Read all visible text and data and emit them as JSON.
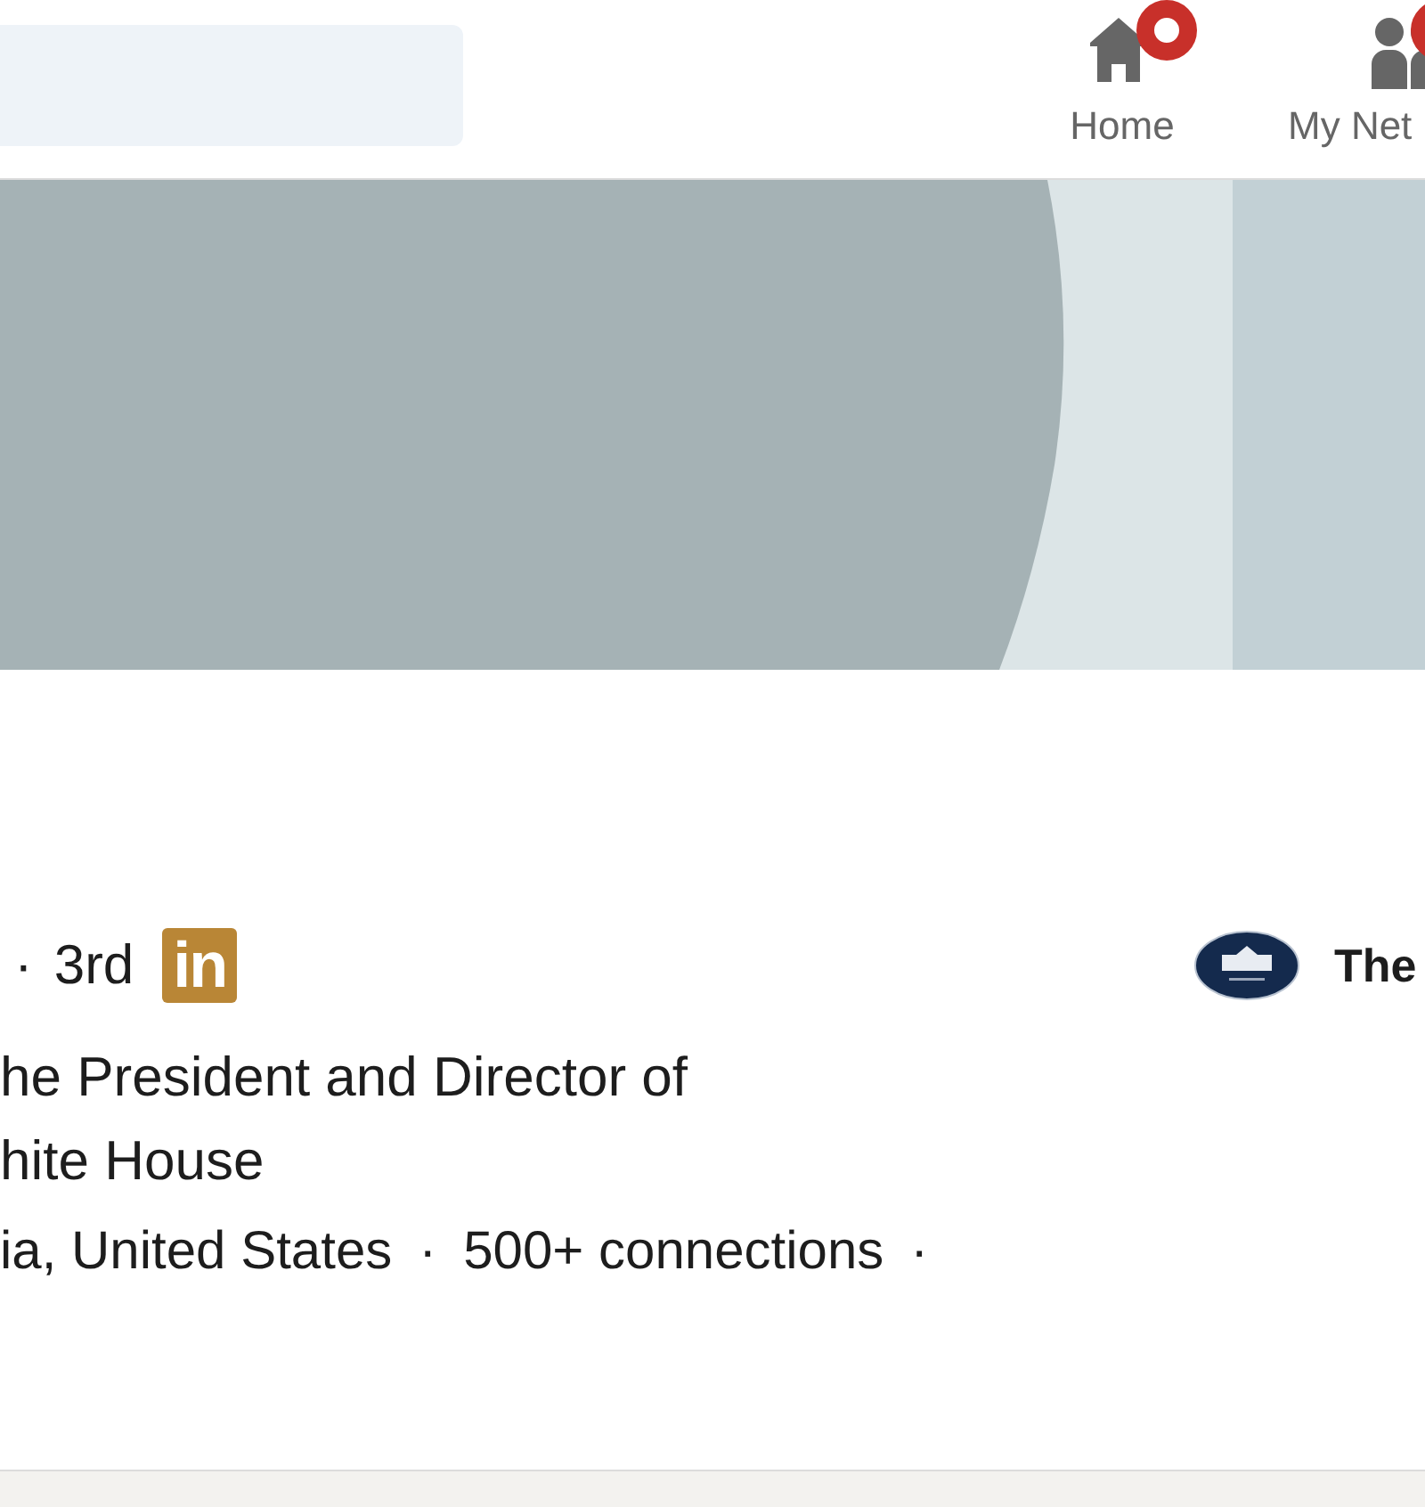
{
  "nav": [
    {
      "label": "Home",
      "kind": "home",
      "notification": true
    },
    {
      "label": "My Net",
      "kind": "network",
      "notification": true
    }
  ],
  "profile": {
    "separator": "·",
    "degree": "3rd",
    "logo_text": "in",
    "headline": [
      "he President and Director of",
      "hite House"
    ],
    "location": "ia, United States",
    "connections": "500+ connections",
    "trailing_separator": "·",
    "company": {
      "name": "The"
    }
  }
}
